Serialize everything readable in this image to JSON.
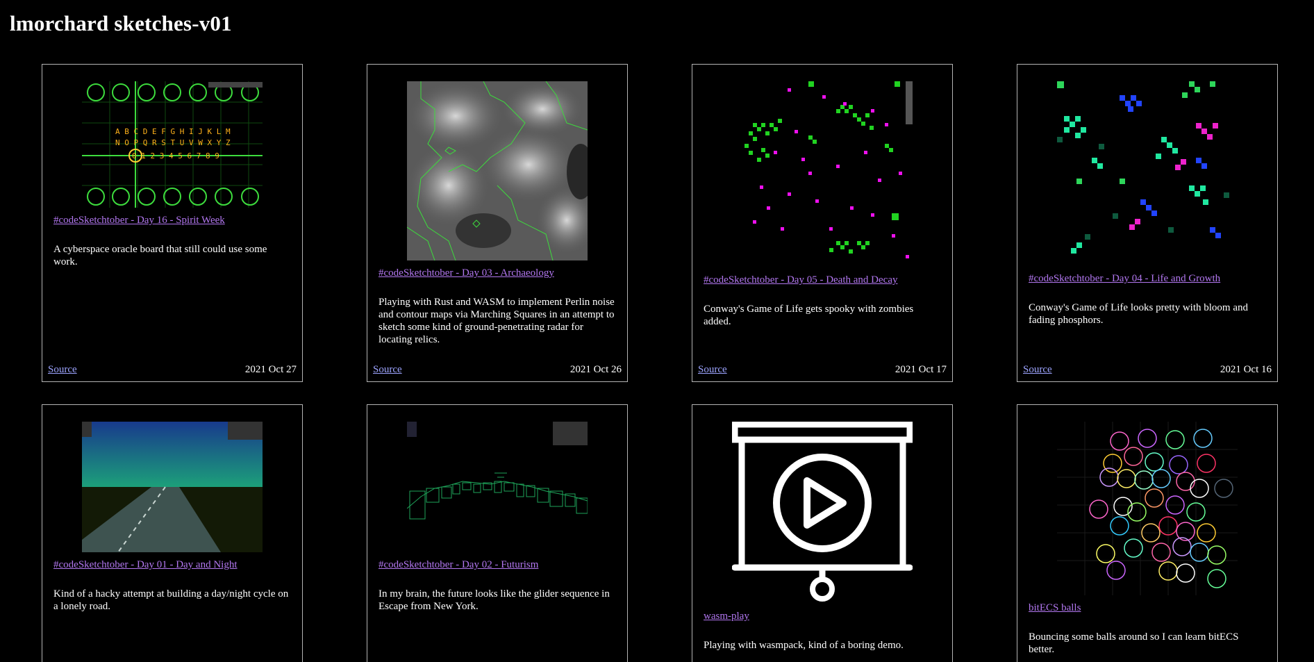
{
  "page": {
    "title": "lmorchard sketches-v01"
  },
  "cards": [
    {
      "title": "#codeSketchtober - Day 16 - Spirit Week",
      "description": "A cyberspace oracle board that still could use some work.",
      "source_label": "Source",
      "date": "2021 Oct 27",
      "thumb_text_top": "A B C D E F G H I J K L M",
      "thumb_text_mid": "N O P Q R S T U V W X Y Z",
      "thumb_text_bot": "0 1 2 3 4 5 6 7 8 9"
    },
    {
      "title": "#codeSketchtober - Day 03 - Archaeology",
      "description": "Playing with Rust and WASM to implement Perlin noise and contour maps via Marching Squares in an attempt to sketch some kind of ground-penetrating radar for locating relics.",
      "source_label": "Source",
      "date": "2021 Oct 26"
    },
    {
      "title": "#codeSketchtober - Day 05 - Death and Decay",
      "description": "Conway's Game of Life gets spooky with zombies added.",
      "source_label": "Source",
      "date": "2021 Oct 17"
    },
    {
      "title": "#codeSketchtober - Day 04 - Life and Growth",
      "description": "Conway's Game of Life looks pretty with bloom and fading phosphors.",
      "source_label": "Source",
      "date": "2021 Oct 16"
    },
    {
      "title": "#codeSketchtober - Day 01 - Day and Night",
      "description": "Kind of a hacky attempt at building a day/night cycle on a lonely road."
    },
    {
      "title": "#codeSketchtober - Day 02 - Futurism",
      "description": "In my brain, the future looks like the glider sequence in Escape from New York."
    },
    {
      "title": "wasm-play",
      "description": "Playing with wasmpack, kind of a boring demo."
    },
    {
      "title": "bitECS balls",
      "description": "Bouncing some balls around so I can learn bitECS better."
    }
  ],
  "colors": {
    "link": "#b277f0",
    "source_link": "#9da4ff",
    "border": "#b5b5b5",
    "background": "#000000"
  }
}
